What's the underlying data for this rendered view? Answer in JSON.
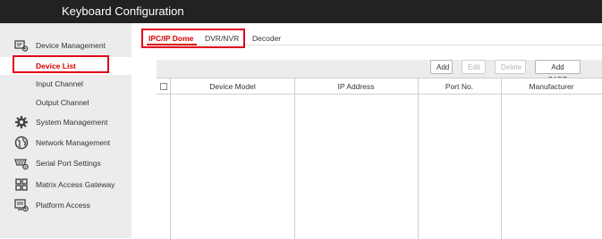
{
  "header": {
    "title": "Keyboard Configuration"
  },
  "sidebar": {
    "items": [
      {
        "label": "Device Management",
        "icon": "device-management-icon"
      },
      {
        "label": "Device List",
        "active": true
      },
      {
        "label": "Input Channel"
      },
      {
        "label": "Output Channel"
      },
      {
        "label": "System Management",
        "icon": "gear-icon"
      },
      {
        "label": "Network Management",
        "icon": "globe-icon"
      },
      {
        "label": "Serial Port Settings",
        "icon": "serial-port-icon"
      },
      {
        "label": "Matrix Access Gateway",
        "icon": "matrix-grid-icon"
      },
      {
        "label": "Platform Access",
        "icon": "platform-access-icon"
      }
    ]
  },
  "tabs": [
    {
      "label": "IPC/IP Dome",
      "active": true
    },
    {
      "label": "DVR/NVR"
    },
    {
      "label": "Decoder"
    }
  ],
  "toolbar": {
    "add": "Add",
    "edit": "Edit",
    "delete": "Delete",
    "add_sadp": "Add SADP"
  },
  "table": {
    "columns": [
      "Device Model",
      "IP Address",
      "Port No.",
      "Manufacturer"
    ],
    "rows": []
  },
  "colors": {
    "titlebar": "#222222",
    "accent": "#d40000",
    "highlight_box": "#e0001b",
    "sidebar_bg": "#ececec"
  }
}
